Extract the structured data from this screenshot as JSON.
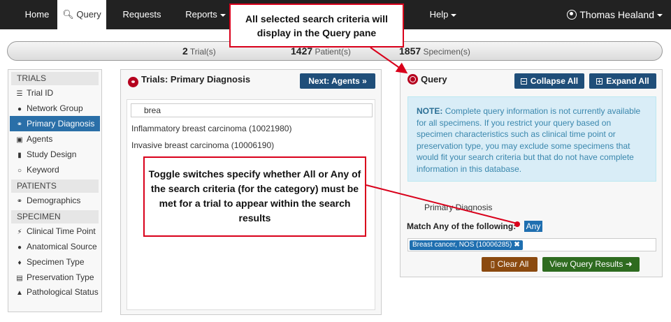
{
  "nav": {
    "home": "Home",
    "query": "Query",
    "requests": "Requests",
    "reports": "Reports",
    "help": "Help",
    "user": "Thomas Healand"
  },
  "counts": {
    "trials_num": "2",
    "trials_label": "Trial(s)",
    "patients_num": "1427",
    "patients_label": "Patient(s)",
    "specimens_num": "1857",
    "specimens_label": "Specimen(s)"
  },
  "sidebar": {
    "trials_header": "TRIALS",
    "patients_header": "PATIENTS",
    "specimen_header": "SPECIMEN",
    "items": [
      {
        "label": "Trial ID",
        "icon": "list-icon"
      },
      {
        "label": "Network Group",
        "icon": "users-icon"
      },
      {
        "label": "Primary Diagnosis",
        "icon": "stethoscope-icon"
      },
      {
        "label": "Agents",
        "icon": "medkit-icon"
      },
      {
        "label": "Study Design",
        "icon": "bar-chart-icon"
      },
      {
        "label": "Keyword",
        "icon": "search-icon"
      },
      {
        "label": "Demographics",
        "icon": "gender-icon"
      },
      {
        "label": "Clinical Time Point",
        "icon": "bolt-icon"
      },
      {
        "label": "Anatomical Source",
        "icon": "person-icon"
      },
      {
        "label": "Specimen Type",
        "icon": "drop-icon"
      },
      {
        "label": "Preservation Type",
        "icon": "archive-icon"
      },
      {
        "label": "Pathological Status",
        "icon": "flask-icon"
      }
    ]
  },
  "middle": {
    "title": "Trials: Primary Diagnosis",
    "next_button": "Next: Agents",
    "search_value": "brea",
    "results": [
      "Inflammatory breast carcinoma (10021980)",
      "Invasive breast carcinoma (10006190)"
    ]
  },
  "query": {
    "title": "Query",
    "collapse_button": "Collapse All",
    "expand_button": "Expand All",
    "note_label": "NOTE:",
    "note_text": "Complete query information is not currently available for all specimens. If you restrict your query based on specimen characteristics such as clinical time point or preservation type, you may exclude some specimens that would fit your search criteria but that do not have complete information in this database.",
    "category": "Primary Diagnosis",
    "match_label": "Match Any of the following:",
    "toggle_value": "Any",
    "tag": "Breast cancer, NOS (10006285)",
    "clear_button": "Clear All",
    "view_button": "View Query Results"
  },
  "callouts": {
    "top": "All selected search criteria will display in the Query pane",
    "middle": "Toggle switches specify whether All or Any of the search criteria (for the category) must be met for a trial to appear within the search results"
  },
  "colors": {
    "accent_red": "#d9001b",
    "nav_dark": "#222222",
    "primary_blue": "#1f4e79",
    "active_blue": "#2a6fa8"
  }
}
